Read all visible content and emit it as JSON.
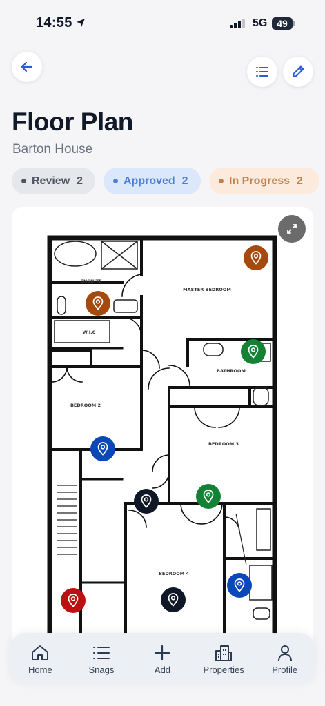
{
  "status_bar": {
    "time": "14:55",
    "network": "5G",
    "battery": "49"
  },
  "header": {
    "title": "Floor Plan",
    "subtitle": "Barton House"
  },
  "filters": [
    {
      "label": "Review",
      "count": "2",
      "color": "#4b5563"
    },
    {
      "label": "Approved",
      "count": "2",
      "color": "#4f7fd4"
    },
    {
      "label": "In Progress",
      "count": "2",
      "color": "#c0814f"
    }
  ],
  "floor_plan": {
    "rooms": {
      "ensuite": "ENSUITE",
      "master_bedroom": "MASTER BEDROOM",
      "wic": "W.I.C",
      "bathroom": "BATHROOM",
      "bedroom_2": "BEDROOM 2",
      "bedroom_3": "BEDROOM 3",
      "bedroom_4": "BEDROOM 4"
    },
    "pin_colors": {
      "in_progress": "#a54a0c",
      "approved": "#148235",
      "review": "#101827",
      "blue": "#0a47b8",
      "red": "#bd1010"
    }
  },
  "tab_bar": {
    "items": [
      {
        "label": "Home",
        "icon": "home-icon"
      },
      {
        "label": "Snags",
        "icon": "list-icon"
      },
      {
        "label": "Add",
        "icon": "plus-icon"
      },
      {
        "label": "Properties",
        "icon": "building-icon"
      },
      {
        "label": "Profile",
        "icon": "person-icon"
      }
    ]
  }
}
